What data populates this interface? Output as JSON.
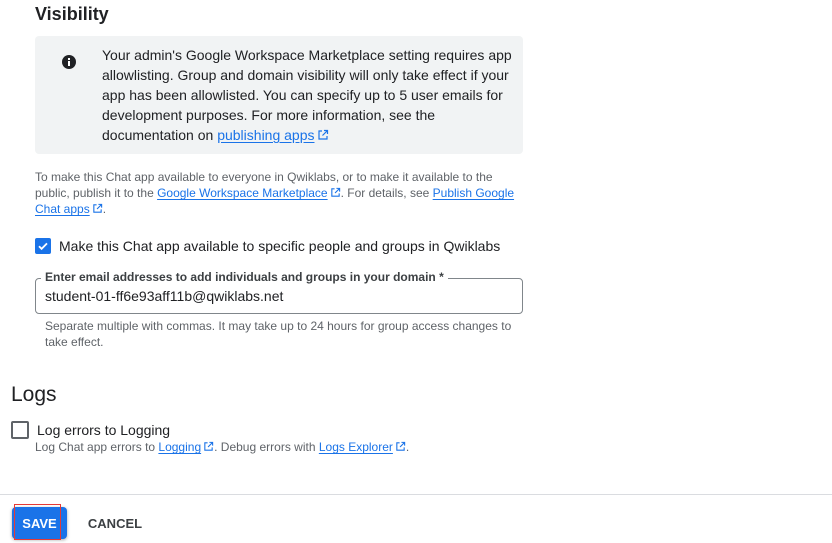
{
  "visibility": {
    "title": "Visibility",
    "notice": {
      "icon": "info-icon",
      "text": "Your admin's Google Workspace Marketplace setting requires app allowlisting. Group and domain visibility will only take effect if your app has been allowlisted. You can specify up to 5 user emails for development purposes. For more information, see the documentation on ",
      "link": "publishing apps"
    },
    "publish_note": {
      "part1": "To make this Chat app available to everyone in Qwiklabs, or to make it available to the public, publish it to the ",
      "link1": "Google Workspace Marketplace",
      "part2": ". For details, see ",
      "link2": "Publish Google Chat apps",
      "part3": "."
    },
    "specific_checkbox": {
      "label": "Make this Chat app available to specific people and groups in Qwiklabs",
      "checked": true
    },
    "email_field": {
      "label": "Enter email addresses to add individuals and groups in your domain *",
      "value": "student-01-ff6e93aff11b@qwiklabs.net",
      "hint": "Separate multiple with commas. It may take up to 24 hours for group access changes to take effect."
    }
  },
  "logs": {
    "title": "Logs",
    "checkbox": {
      "label": "Log errors to Logging",
      "checked": false
    },
    "desc": {
      "part1": "Log Chat app errors to ",
      "link1": "Logging",
      "part2": ". Debug errors with ",
      "link2": "Logs Explorer",
      "part3": "."
    }
  },
  "footer": {
    "save_label": "SAVE",
    "cancel_label": "CANCEL"
  },
  "colors": {
    "accent": "#1a73e8",
    "notice_bg": "#f1f3f4",
    "highlight": "#e53935"
  }
}
